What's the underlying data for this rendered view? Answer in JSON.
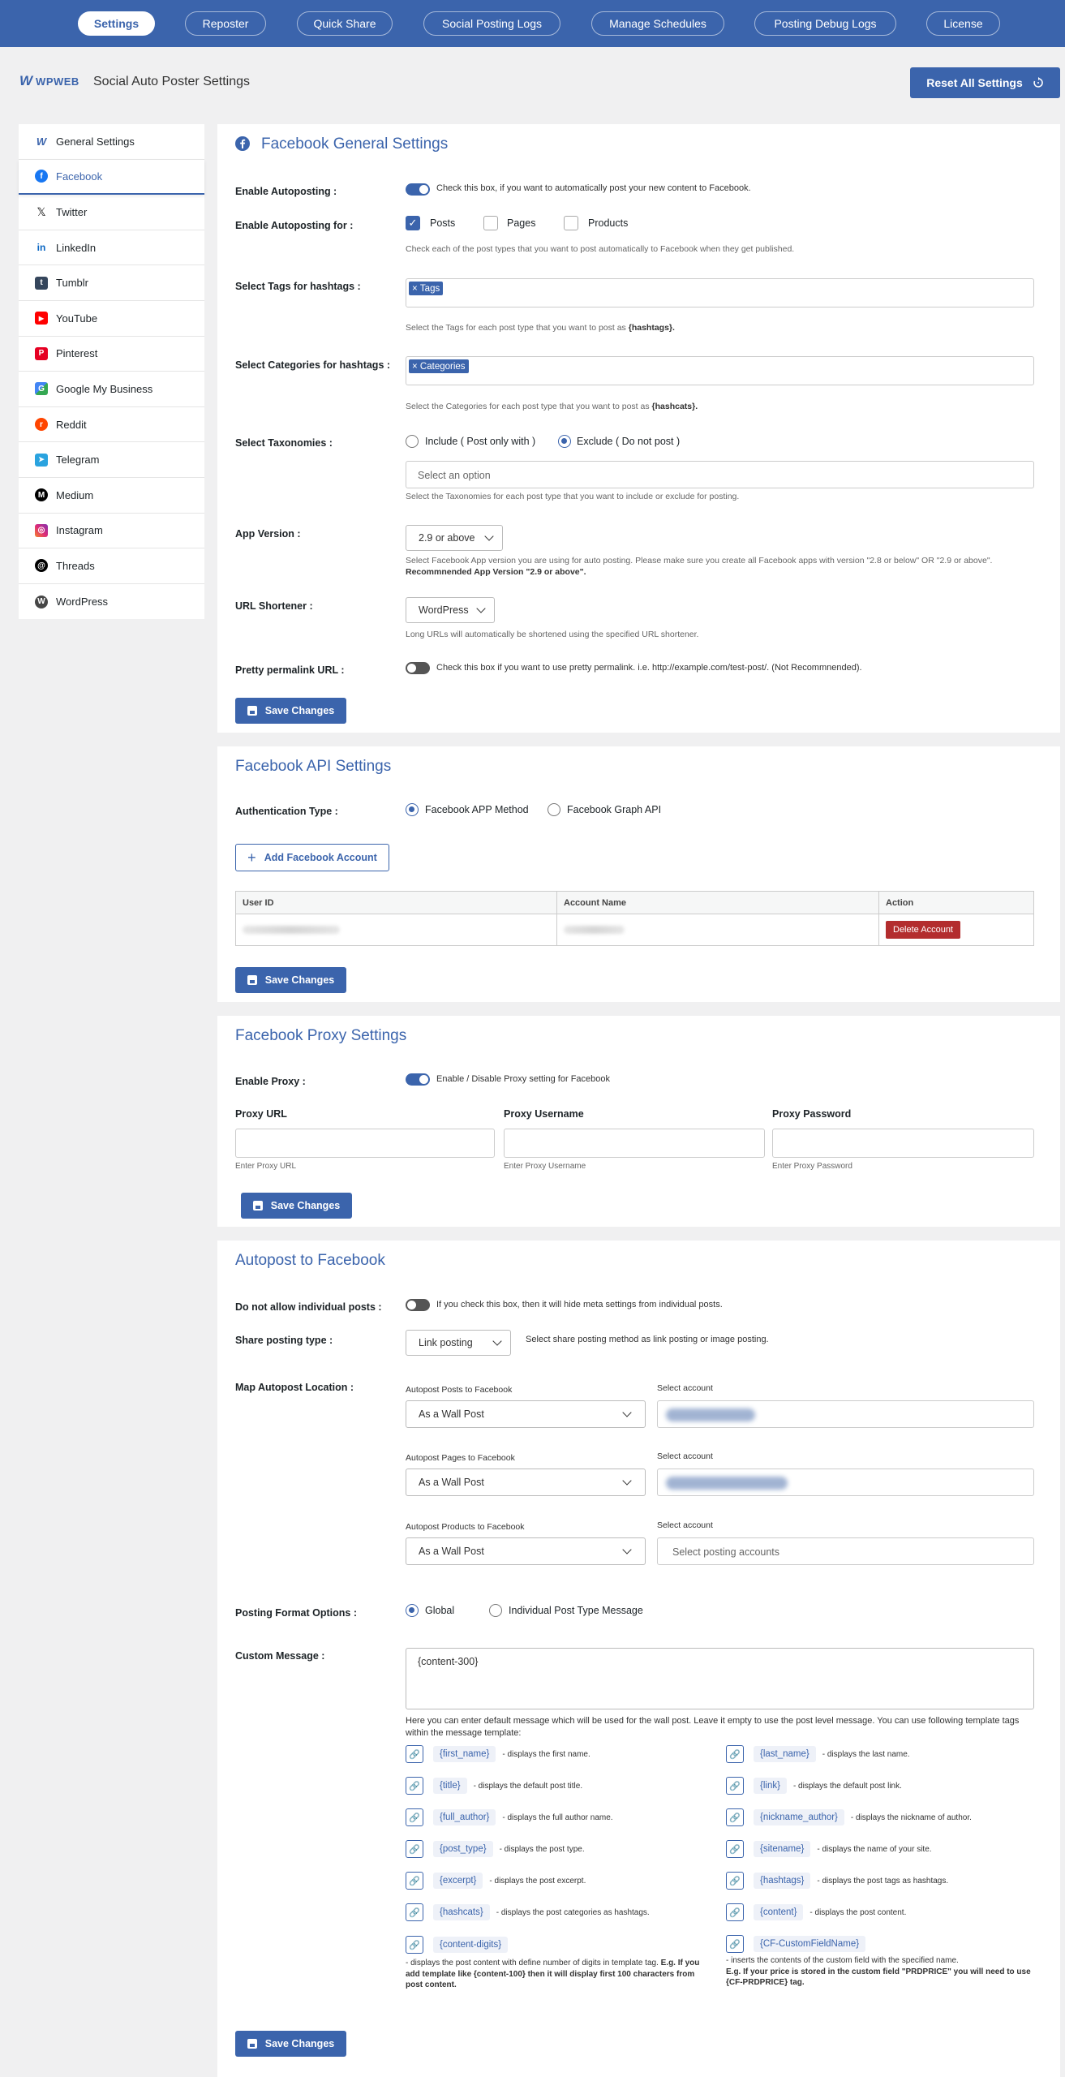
{
  "nav": {
    "tabs": [
      {
        "label": "Settings"
      },
      {
        "label": "Reposter"
      },
      {
        "label": "Quick Share"
      },
      {
        "label": "Social Posting Logs"
      },
      {
        "label": "Manage Schedules"
      },
      {
        "label": "Posting Debug Logs"
      },
      {
        "label": "License"
      }
    ]
  },
  "header": {
    "logo_text": "WPWEB",
    "title": "Social Auto Poster Settings",
    "reset_label": "Reset All Settings"
  },
  "sidebar": {
    "items": [
      {
        "label": "General Settings",
        "icon": "wpweb-icon",
        "color": "#3b64ac"
      },
      {
        "label": "Facebook",
        "icon": "facebook-icon",
        "color": "#1877f2"
      },
      {
        "label": "Twitter",
        "icon": "x-icon",
        "color": "#111111"
      },
      {
        "label": "LinkedIn",
        "icon": "linkedin-icon",
        "color": "#0a66c2"
      },
      {
        "label": "Tumblr",
        "icon": "tumblr-icon",
        "color": "#35465c"
      },
      {
        "label": "YouTube",
        "icon": "youtube-icon",
        "color": "#ff0000"
      },
      {
        "label": "Pinterest",
        "icon": "pinterest-icon",
        "color": "#e60023"
      },
      {
        "label": "Google My Business",
        "icon": "google-my-business-icon",
        "color": "#4285f4"
      },
      {
        "label": "Reddit",
        "icon": "reddit-icon",
        "color": "#ff4500"
      },
      {
        "label": "Telegram",
        "icon": "telegram-icon",
        "color": "#2aa3df"
      },
      {
        "label": "Medium",
        "icon": "medium-icon",
        "color": "#000000"
      },
      {
        "label": "Instagram",
        "icon": "instagram-icon",
        "color": "#d6249f"
      },
      {
        "label": "Threads",
        "icon": "threads-icon",
        "color": "#000000"
      },
      {
        "label": "WordPress",
        "icon": "wordpress-icon",
        "color": "#464646"
      }
    ]
  },
  "general": {
    "title": "Facebook General Settings",
    "enable_autoposting_label": "Enable Autoposting :",
    "enable_autoposting_hint": "Check this box, if you want to automatically post your new content to Facebook.",
    "enable_autoposting_for_label": "Enable Autoposting for :",
    "post_types": [
      {
        "label": "Posts",
        "checked": true
      },
      {
        "label": "Pages",
        "checked": false
      },
      {
        "label": "Products",
        "checked": false
      }
    ],
    "post_types_hint": "Check each of the post types that you want to post automatically to Facebook when they get published.",
    "tags_label": "Select Tags for hashtags :",
    "tags_chip": "Tags",
    "tags_hint_pre": "Select the Tags for each post type that you want to post as ",
    "tags_hint_bold": "{hashtags}.",
    "categories_label": "Select Categories for hashtags :",
    "categories_chip": "Categories",
    "categories_hint_pre": "Select the Categories for each post type that you want to post as ",
    "categories_hint_bold": "{hashcats}.",
    "taxonomies_label": "Select Taxonomies :",
    "tax_include": "Include ( Post only with )",
    "tax_exclude": "Exclude ( Do not post )",
    "tax_placeholder": "Select an option",
    "tax_hint": "Select the Taxonomies for each post type that you want to include or exclude for posting.",
    "app_version_label": "App Version :",
    "app_version_value": "2.9 or above",
    "app_version_hint": "Select Facebook App version you are using for auto posting. Please make sure you create all Facebook apps with version \"2.8 or below\" OR \"2.9 or above\".",
    "app_version_hint_bold": "Recommnended App Version \"2.9 or above\".",
    "url_shortener_label": "URL Shortener :",
    "url_shortener_value": "WordPress",
    "url_shortener_hint": "Long URLs will automatically be shortened using the specified URL shortener.",
    "pretty_label": "Pretty permalink URL :",
    "pretty_hint": "Check this box if you want to use pretty permalink. i.e. http://example.com/test-post/. (Not Recommnended).",
    "save_label": "Save Changes"
  },
  "api": {
    "title": "Facebook API Settings",
    "auth_label": "Authentication Type :",
    "auth_app": "Facebook APP Method",
    "auth_graph": "Facebook Graph API",
    "add_account_label": "Add Facebook Account",
    "table_headers": [
      "User ID",
      "Account Name",
      "Action"
    ],
    "delete_label": "Delete Account",
    "save_label": "Save Changes"
  },
  "proxy": {
    "title": "Facebook Proxy Settings",
    "enable_label": "Enable Proxy :",
    "enable_hint": "Enable / Disable Proxy setting for Facebook",
    "fields": [
      {
        "label": "Proxy URL",
        "hint": "Enter Proxy URL"
      },
      {
        "label": "Proxy Username",
        "hint": "Enter Proxy Username"
      },
      {
        "label": "Proxy Password",
        "hint": "Enter Proxy Password"
      }
    ],
    "save_label": "Save Changes"
  },
  "autopost": {
    "title": "Autopost to Facebook",
    "disallow_label": "Do not allow individual posts :",
    "disallow_hint": "If you check this box, then it will hide meta settings from individual posts.",
    "share_type_label": "Share posting type :",
    "share_type_value": "Link posting",
    "share_type_hint": "Select share posting method as link posting or image posting.",
    "map_label": "Map Autopost Location :",
    "locations": [
      {
        "label": "Autopost Posts to Facebook",
        "value": "As a Wall Post",
        "account_label": "Select account",
        "account_placeholder": ""
      },
      {
        "label": "Autopost Pages to Facebook",
        "value": "As a Wall Post",
        "account_label": "Select account",
        "account_placeholder": ""
      },
      {
        "label": "Autopost Products to Facebook",
        "value": "As a Wall Post",
        "account_label": "Select account",
        "account_placeholder": "Select posting accounts"
      }
    ],
    "format_label": "Posting Format Options :",
    "format_global": "Global",
    "format_individual": "Individual Post Type Message",
    "custom_label": "Custom Message :",
    "custom_value": "{content-300}",
    "custom_hint": "Here you can enter default message which will be used for the wall post. Leave it empty to use the post level message. You can use following template tags within the message template:",
    "tags_left": [
      {
        "code": "{first_name}",
        "desc": "- displays the first name."
      },
      {
        "code": "{title}",
        "desc": "- displays the default post title."
      },
      {
        "code": "{full_author}",
        "desc": "- displays the full author name."
      },
      {
        "code": "{post_type}",
        "desc": "- displays the post type."
      },
      {
        "code": "{excerpt}",
        "desc": "- displays the post excerpt."
      },
      {
        "code": "{hashcats}",
        "desc": "- displays the post categories as hashtags."
      },
      {
        "code": "{content-digits}",
        "desc": ""
      }
    ],
    "tags_right": [
      {
        "code": "{last_name}",
        "desc": "- displays the last name."
      },
      {
        "code": "{link}",
        "desc": "- displays the default post link."
      },
      {
        "code": "{nickname_author}",
        "desc": "- displays the nickname of author."
      },
      {
        "code": "{sitename}",
        "desc": "- displays the name of your site."
      },
      {
        "code": "{hashtags}",
        "desc": "- displays the post tags as hashtags."
      },
      {
        "code": "{content}",
        "desc": "- displays the post content."
      },
      {
        "code": "{CF-CustomFieldName}",
        "desc": ""
      }
    ],
    "content_digits_note": "- displays the post content with define number of digits in template tag.",
    "content_digits_note_bold": "E.g. If you add template like {content-100} then it will display first 100 characters from post content.",
    "cf_note": "- inserts the contents of the custom field with the specified name.",
    "cf_note_bold": "E.g. If your price is stored in the custom field \"PRDPRICE\" you will need to use {CF-PRDPRICE} tag.",
    "save_label": "Save Changes"
  }
}
